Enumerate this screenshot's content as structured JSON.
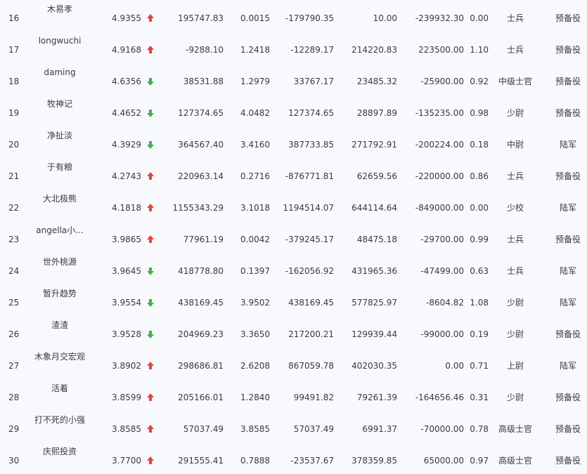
{
  "colors": {
    "up": "#e64340",
    "down": "#3cb34a",
    "text": "#3a3a3a",
    "background": "#f7f9fc"
  },
  "rows": [
    {
      "rank": "16",
      "name": "木易孝",
      "score": "4.9355",
      "trend": "up",
      "v1": "195747.83",
      "v2": "0.0015",
      "v3": "-179790.35",
      "v4": "10.00",
      "v5": "-239932.30",
      "v6": "0.00",
      "rank_name": "士兵",
      "unit": "预备役"
    },
    {
      "rank": "17",
      "name": "longwuchi",
      "score": "4.9168",
      "trend": "up",
      "v1": "-9288.10",
      "v2": "1.2418",
      "v3": "-12289.17",
      "v4": "214220.83",
      "v5": "223500.00",
      "v6": "1.10",
      "rank_name": "士兵",
      "unit": "预备役"
    },
    {
      "rank": "18",
      "name": "daming",
      "score": "4.6356",
      "trend": "down",
      "v1": "38531.88",
      "v2": "1.2979",
      "v3": "33767.17",
      "v4": "23485.32",
      "v5": "-25900.00",
      "v6": "0.92",
      "rank_name": "中级士官",
      "unit": "预备役"
    },
    {
      "rank": "19",
      "name": "牧神记",
      "score": "4.4652",
      "trend": "down",
      "v1": "127374.65",
      "v2": "4.0482",
      "v3": "127374.65",
      "v4": "28897.89",
      "v5": "-135235.00",
      "v6": "0.98",
      "rank_name": "少尉",
      "unit": "预备役"
    },
    {
      "rank": "20",
      "name": "净扯淡",
      "score": "4.3929",
      "trend": "down",
      "v1": "364567.40",
      "v2": "3.4160",
      "v3": "387733.85",
      "v4": "271792.91",
      "v5": "-200224.00",
      "v6": "0.18",
      "rank_name": "中尉",
      "unit": "陆军"
    },
    {
      "rank": "21",
      "name": "于有粮",
      "score": "4.2743",
      "trend": "up",
      "v1": "220963.14",
      "v2": "0.2716",
      "v3": "-876771.81",
      "v4": "62659.56",
      "v5": "-220000.00",
      "v6": "0.86",
      "rank_name": "士兵",
      "unit": "预备役"
    },
    {
      "rank": "22",
      "name": "大北极熊",
      "score": "4.1818",
      "trend": "up",
      "v1": "1155343.29",
      "v2": "3.1018",
      "v3": "1194514.07",
      "v4": "644114.64",
      "v5": "-849000.00",
      "v6": "0.00",
      "rank_name": "少校",
      "unit": "陆军"
    },
    {
      "rank": "23",
      "name": "angella小...",
      "score": "3.9865",
      "trend": "up",
      "v1": "77961.19",
      "v2": "0.0042",
      "v3": "-379245.17",
      "v4": "48475.18",
      "v5": "-29700.00",
      "v6": "0.99",
      "rank_name": "士兵",
      "unit": "预备役"
    },
    {
      "rank": "24",
      "name": "世外桃源",
      "score": "3.9645",
      "trend": "down",
      "v1": "418778.80",
      "v2": "0.1397",
      "v3": "-162056.92",
      "v4": "431965.36",
      "v5": "-47499.00",
      "v6": "0.63",
      "rank_name": "士兵",
      "unit": "陆军"
    },
    {
      "rank": "25",
      "name": "暂升趋势",
      "score": "3.9554",
      "trend": "down",
      "v1": "438169.45",
      "v2": "3.9502",
      "v3": "438169.45",
      "v4": "577825.97",
      "v5": "-8604.82",
      "v6": "1.08",
      "rank_name": "少尉",
      "unit": "陆军"
    },
    {
      "rank": "26",
      "name": "渣渣",
      "score": "3.9528",
      "trend": "down",
      "v1": "204969.23",
      "v2": "3.3650",
      "v3": "217200.21",
      "v4": "129939.44",
      "v5": "-99000.00",
      "v6": "0.19",
      "rank_name": "少尉",
      "unit": "预备役"
    },
    {
      "rank": "27",
      "name": "木象月交宏观",
      "score": "3.8902",
      "trend": "up",
      "v1": "298686.81",
      "v2": "2.6208",
      "v3": "867059.78",
      "v4": "402030.35",
      "v5": "0.00",
      "v6": "0.71",
      "rank_name": "上尉",
      "unit": "陆军"
    },
    {
      "rank": "28",
      "name": "活着",
      "score": "3.8599",
      "trend": "up",
      "v1": "205166.01",
      "v2": "1.2840",
      "v3": "99491.82",
      "v4": "79261.39",
      "v5": "-164656.46",
      "v6": "0.31",
      "rank_name": "少尉",
      "unit": "预备役"
    },
    {
      "rank": "29",
      "name": "打不死的小强",
      "score": "3.8585",
      "trend": "up",
      "v1": "57037.49",
      "v2": "3.8585",
      "v3": "57037.49",
      "v4": "6991.37",
      "v5": "-70000.00",
      "v6": "0.78",
      "rank_name": "高级士官",
      "unit": "预备役"
    },
    {
      "rank": "30",
      "name": "庆熙投资",
      "score": "3.7700",
      "trend": "up",
      "v1": "291555.41",
      "v2": "0.7888",
      "v3": "-23537.67",
      "v4": "378359.85",
      "v5": "65000.00",
      "v6": "0.97",
      "rank_name": "高级士官",
      "unit": "预备役"
    }
  ]
}
